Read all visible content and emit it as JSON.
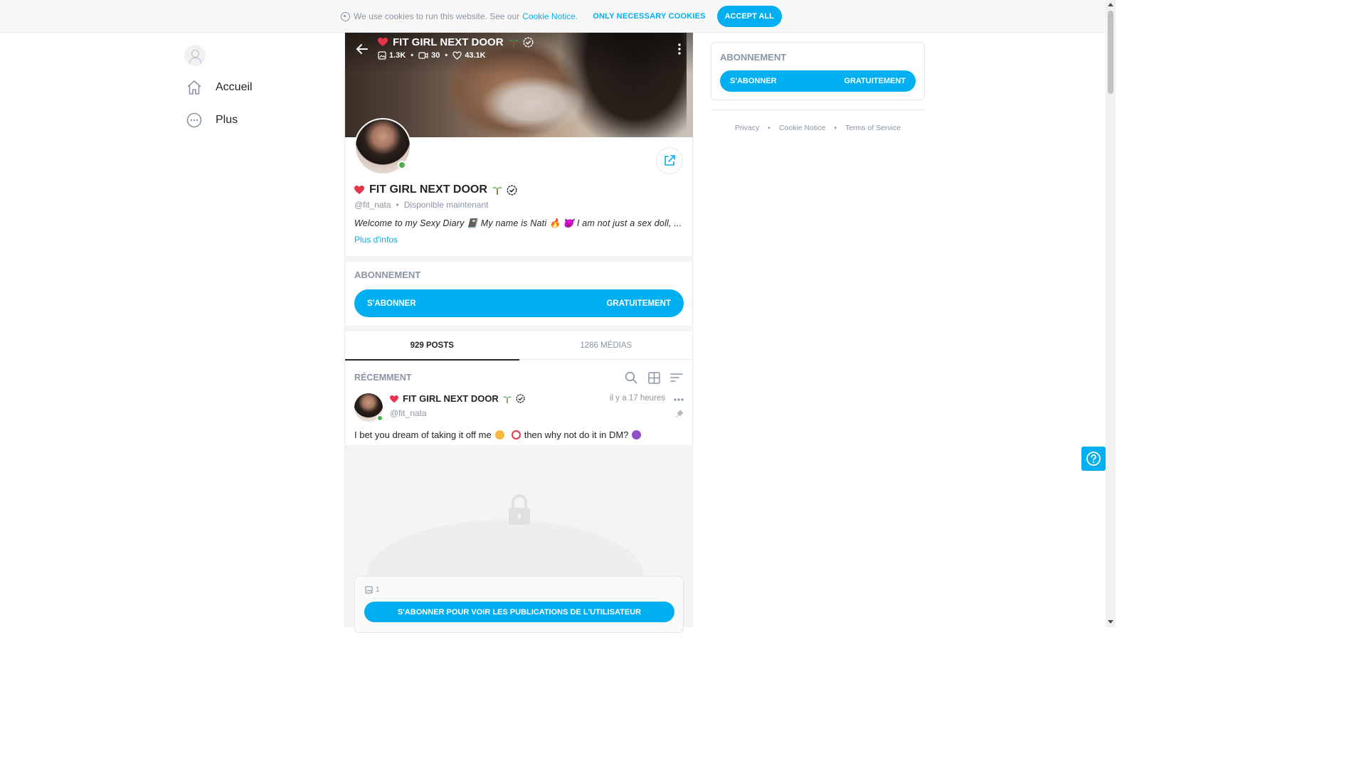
{
  "cookie_bar": {
    "message": "We use cookies to run this website. See our",
    "notice_link": "Cookie Notice.",
    "only_necessary": "ONLY NECESSARY COOKIES",
    "accept_all": "ACCEPT ALL"
  },
  "sidebar": {
    "items": [
      {
        "label": "Accueil",
        "icon": "home-icon"
      },
      {
        "label": "Plus",
        "icon": "more-circle-icon"
      }
    ]
  },
  "profile": {
    "name": "FIT GIRL NEXT DOOR",
    "handle": "@fit_nata",
    "status": "Disponible maintenant",
    "stats": {
      "photos": "1.3K",
      "videos": "30",
      "likes": "43.1K"
    },
    "bio": "Welcome to my Sexy Diary 📓 My name is Nati 🔥 😈 I am not just a sex doll, ...",
    "more_info": "Plus d'infos"
  },
  "subscription": {
    "section_label": "ABONNEMENT",
    "subscribe_label": "S'ABONNER",
    "price_label": "GRATUITEMENT"
  },
  "tabs": [
    {
      "label": "929 POSTS",
      "active": true
    },
    {
      "label": "1286 MÉDIAS",
      "active": false
    }
  ],
  "feed": {
    "recent_label": "RÉCEMMENT",
    "post": {
      "author": "FIT GIRL NEXT DOOR",
      "handle": "@fit_nata",
      "time": "il y a 17 heures",
      "text_part1": "I bet you dream of taking it off me",
      "text_part2": "then why not do it in DM?",
      "media_count": "1",
      "unlock_label": "S'ABONNER POUR VOIR LES PUBLICATIONS DE L'UTILISATEUR"
    }
  },
  "right_panel": {
    "label": "ABONNEMENT",
    "subscribe_label": "S'ABONNER",
    "price_label": "GRATUITEMENT",
    "footer": [
      "Privacy",
      "Cookie Notice",
      "Terms of Service"
    ]
  },
  "colors": {
    "accent": "#00aff0",
    "text": "#242529",
    "muted": "#8a96a3",
    "online": "#4caf50"
  }
}
